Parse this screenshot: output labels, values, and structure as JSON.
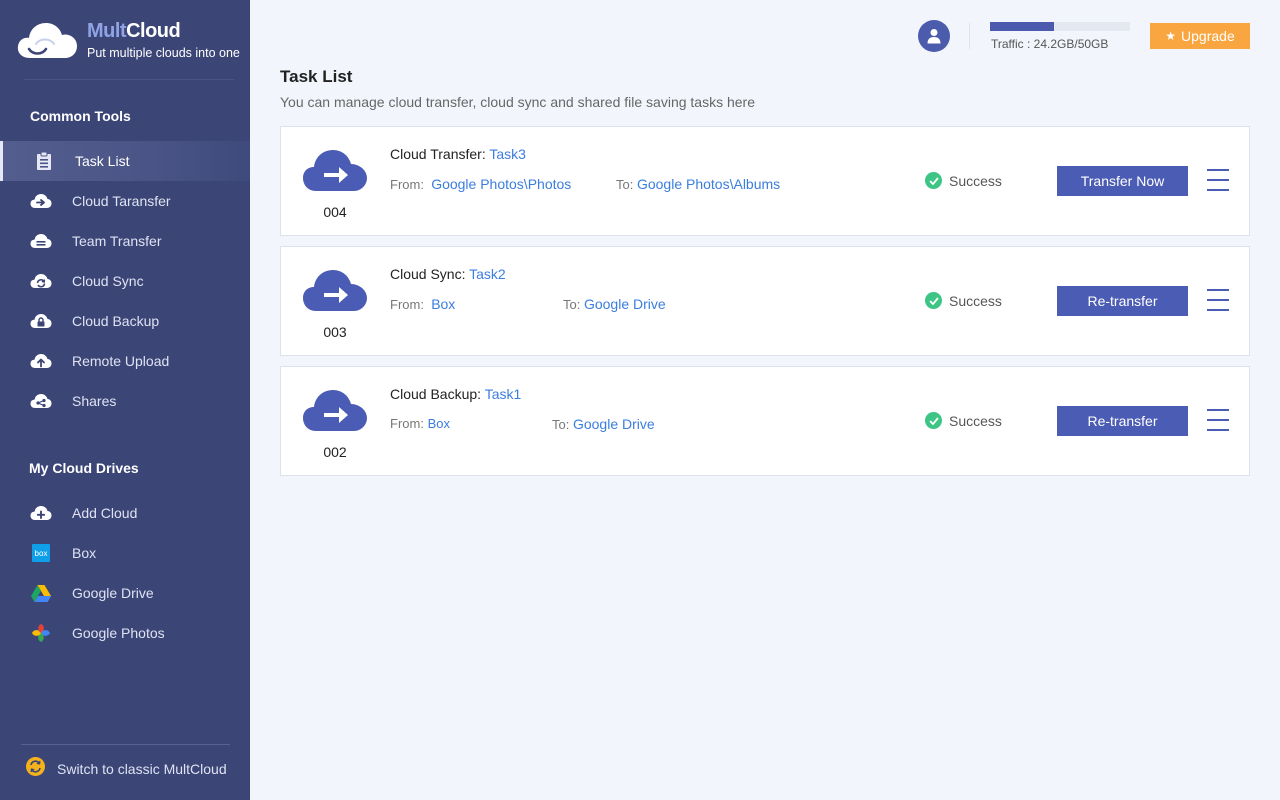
{
  "app": {
    "brand_prefix": "Mult",
    "brand_suffix": "Cloud",
    "tagline": "Put multiple clouds into one"
  },
  "sidebar": {
    "common_tools_title": "Common Tools",
    "common_tools": [
      {
        "label": "Task List",
        "icon": "clipboard-icon",
        "active": true
      },
      {
        "label": "Cloud Taransfer",
        "icon": "cloud-transfer-icon"
      },
      {
        "label": "Team Transfer",
        "icon": "team-transfer-icon"
      },
      {
        "label": "Cloud Sync",
        "icon": "cloud-sync-icon"
      },
      {
        "label": "Cloud Backup",
        "icon": "cloud-backup-icon"
      },
      {
        "label": "Remote Upload",
        "icon": "remote-upload-icon"
      },
      {
        "label": "Shares",
        "icon": "share-icon"
      }
    ],
    "my_drives_title": "My Cloud Drives",
    "drives": [
      {
        "label": "Add Cloud",
        "icon": "add-cloud-icon"
      },
      {
        "label": "Box",
        "icon": "box-logo-icon",
        "badge": "box"
      },
      {
        "label": "Google Drive",
        "icon": "google-drive-icon"
      },
      {
        "label": "Google Photos",
        "icon": "google-photos-icon"
      }
    ],
    "switch_label": "Switch to classic MultCloud"
  },
  "header": {
    "traffic_label": "Traffic : 24.2GB/50GB",
    "traffic_used_fraction": 0.46,
    "upgrade_label": "Upgrade"
  },
  "main": {
    "title": "Task List",
    "subtitle": "You can manage cloud transfer, cloud sync and shared file saving tasks here",
    "tasks": [
      {
        "number": "004",
        "type": "Cloud Transfer:",
        "name": "Task3",
        "from_label": "From:",
        "from": "Google Photos\\Photos",
        "to_label": "To:",
        "to": "Google Photos\\Albums",
        "status": "Success",
        "action": "Transfer Now"
      },
      {
        "number": "003",
        "type": "Cloud Sync:",
        "name": "Task2",
        "from_label": "From:",
        "from": "Box",
        "to_label": "To:",
        "to": "Google Drive",
        "status": "Success",
        "action": "Re-transfer"
      },
      {
        "number": "002",
        "type": "Cloud Backup:",
        "name": "Task1",
        "from_label": "From:",
        "from": "Box",
        "to_label": "To:",
        "to": "Google Drive",
        "status": "Success",
        "action": "Re-transfer"
      }
    ]
  },
  "colors": {
    "sidebar_bg": "#3b4576",
    "accent": "#4b5cb4",
    "success": "#3cc585",
    "upgrade": "#f9a640",
    "link": "#3b7de0"
  }
}
